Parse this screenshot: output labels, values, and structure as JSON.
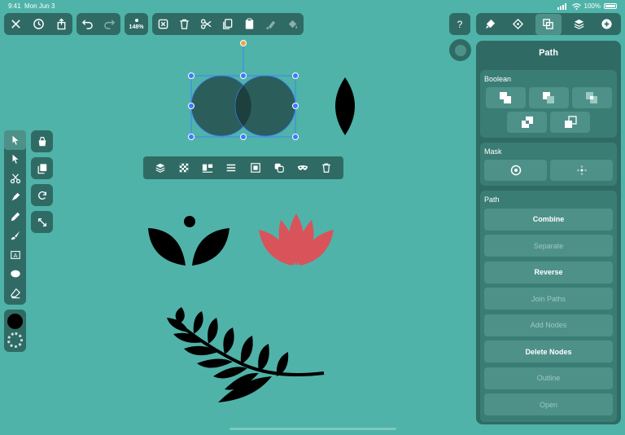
{
  "status": {
    "time": "9:41",
    "date": "Mon Jun 3",
    "battery": "100%"
  },
  "toolbar": {
    "zoom": "148%",
    "left_buttons": [
      "close-icon",
      "history-icon",
      "share-icon"
    ],
    "undo_buttons": [
      "undo-icon",
      "redo-icon"
    ],
    "edit_buttons": [
      "deselect-icon",
      "trash-icon",
      "scissors-icon",
      "copy-icon",
      "paste-icon",
      "paint-icon",
      "fill-icon"
    ],
    "help": "?",
    "right_buttons": [
      "brush-style-icon",
      "node-icon",
      "boolean-icon",
      "layers-icon",
      "add-icon"
    ]
  },
  "panel": {
    "title": "Path",
    "boolean_label": "Boolean",
    "mask_label": "Mask",
    "path_label": "Path",
    "path_buttons": [
      {
        "label": "Combine",
        "enabled": true
      },
      {
        "label": "Separate",
        "enabled": false
      },
      {
        "label": "Reverse",
        "enabled": true
      },
      {
        "label": "Join Paths",
        "enabled": false
      },
      {
        "label": "Add Nodes",
        "enabled": false
      },
      {
        "label": "Delete Nodes",
        "enabled": true
      },
      {
        "label": "Outline",
        "enabled": false
      },
      {
        "label": "Open",
        "enabled": false
      }
    ]
  },
  "tools": [
    "selection-arrow-icon",
    "node-arrow-icon",
    "scissors-icon",
    "pen-icon",
    "pencil-icon",
    "brush-icon",
    "text-icon",
    "ellipse-icon",
    "eraser-icon"
  ],
  "context_menu": [
    "layers-icon",
    "transparency-icon",
    "align-icon",
    "distribute-icon",
    "bounds-icon",
    "arrange-icon",
    "mask-icon",
    "trash-icon"
  ],
  "colors": {
    "background": "#4fb3a9",
    "panel": "#2f6b64",
    "button": "#4e9189",
    "accent_red": "#d9535a",
    "selection": "#3b7bff"
  }
}
